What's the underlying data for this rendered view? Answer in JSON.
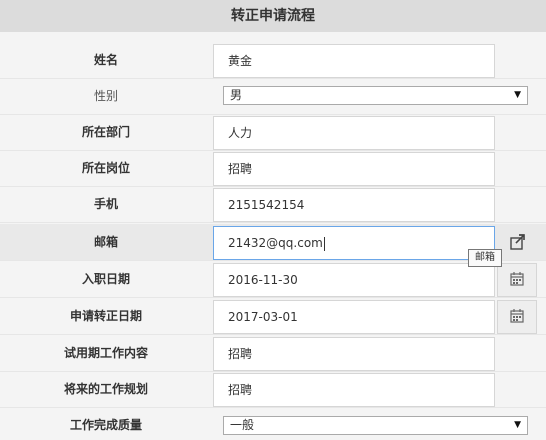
{
  "form": {
    "title": "转正申请流程",
    "fields": {
      "name": {
        "label": "姓名",
        "value": "黄金"
      },
      "gender": {
        "label": "性别",
        "value": "男"
      },
      "department": {
        "label": "所在部门",
        "value": "人力"
      },
      "position": {
        "label": "所在岗位",
        "value": "招聘"
      },
      "phone": {
        "label": "手机",
        "value": "2151542154"
      },
      "email": {
        "label": "邮箱",
        "value": "21432@qq.com",
        "tooltip": "邮箱"
      },
      "entry_date": {
        "label": "入职日期",
        "value": "2016-11-30"
      },
      "regularization_date": {
        "label": "申请转正日期",
        "value": "2017-03-01"
      },
      "probation_work": {
        "label": "试用期工作内容",
        "value": "招聘"
      },
      "future_plan": {
        "label": "将来的工作规划",
        "value": "招聘"
      },
      "work_quality": {
        "label": "工作完成质量",
        "value": "一般"
      }
    }
  },
  "icons": {
    "email_addon": "external-link-icon",
    "date_addon": "calendar-icon",
    "select_arrow": "triangle-down-icon"
  },
  "colors": {
    "title_background": "#dcdcdc",
    "focus_border": "#6aa6e8"
  }
}
